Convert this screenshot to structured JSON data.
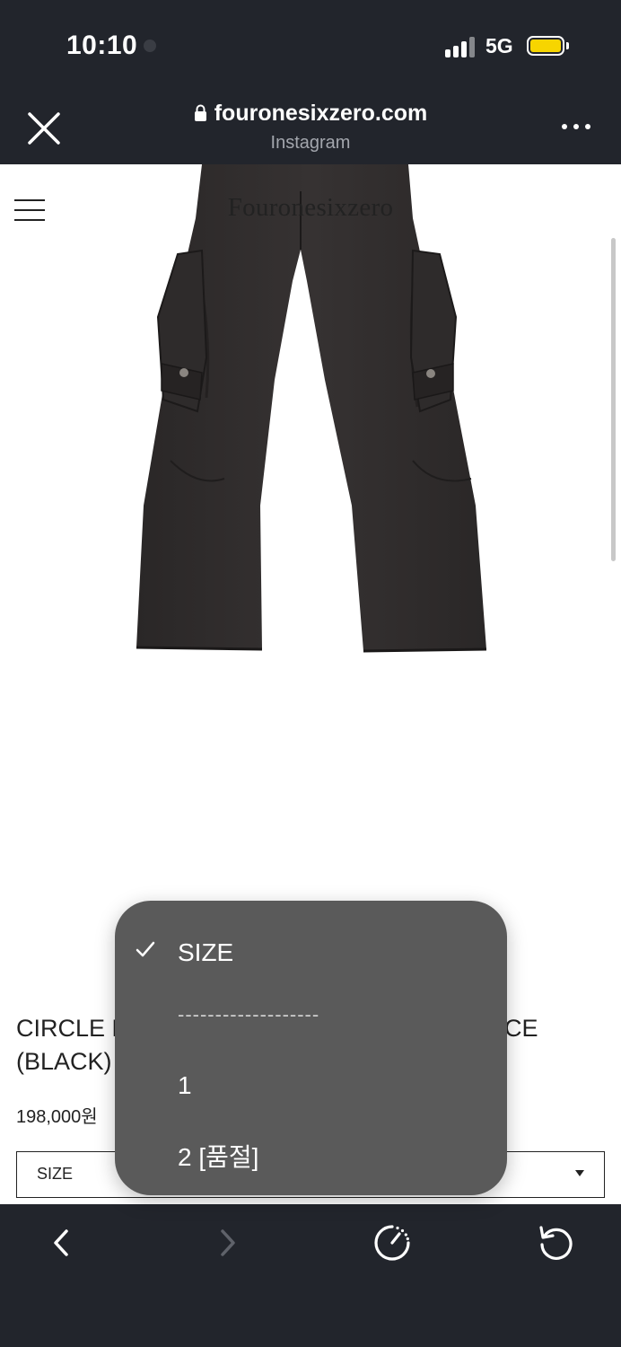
{
  "status_bar": {
    "time": "10:10",
    "network": "5G"
  },
  "browser": {
    "url": "fouronesixzero.com",
    "source": "Instagram"
  },
  "site": {
    "logo": "Fouronesixzero"
  },
  "product": {
    "name_line1": "CIRCLE D",
    "name_line2": "(BLACK)",
    "name_tail": "CE",
    "price": "198,000원"
  },
  "size_select": {
    "selected_label": "SIZE",
    "options": [
      "SIZE",
      "-------------------",
      "1",
      "2 [품절]"
    ]
  },
  "colors": {
    "chrome": "#22252c",
    "popup": "#5a5a5a",
    "battery": "#f7d500"
  },
  "icons": {
    "close": "close-icon",
    "lock": "lock-icon",
    "more": "more-icon",
    "menu": "hamburger-icon",
    "check": "checkmark-icon",
    "back": "chevron-left-icon",
    "forward": "chevron-right-icon",
    "speed": "speedometer-icon",
    "reload": "reload-icon"
  }
}
